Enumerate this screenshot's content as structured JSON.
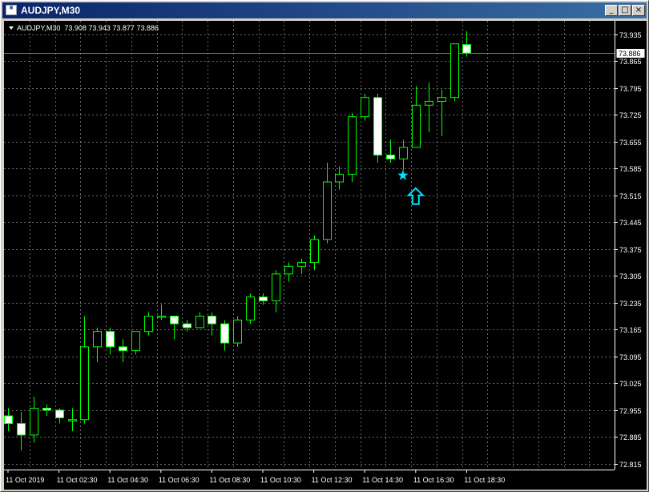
{
  "window": {
    "title": "AUDJPY,M30",
    "icon_name": "chart-window-icon",
    "minimize_label": "_",
    "restore_label": "□",
    "close_label": "×"
  },
  "chart_header": {
    "symbol": "AUDJPY,M30",
    "values": "73.908 73.943 73.877 73.886"
  },
  "colors": {
    "background": "#000000",
    "grid": "#c0c0c0",
    "bull_candle_fill": "#000000",
    "bear_candle_fill": "#ffffff",
    "candle_outline": "#00ff00",
    "bid_line": "#808080",
    "signal": "#00e0ff",
    "axis_text": "#ffffff"
  },
  "chart_data": {
    "type": "candlestick",
    "ylim": [
      72.8,
      73.97
    ],
    "y_ticks": [
      "73.935",
      "73.865",
      "73.795",
      "73.725",
      "73.655",
      "73.585",
      "73.515",
      "73.445",
      "73.375",
      "73.305",
      "73.235",
      "73.165",
      "73.095",
      "73.025",
      "72.955",
      "72.885",
      "72.815"
    ],
    "x_ticks": [
      "11 Oct 2019",
      "11 Oct 02:30",
      "11 Oct 04:30",
      "11 Oct 06:30",
      "11 Oct 08:30",
      "11 Oct 10:30",
      "11 Oct 12:30",
      "11 Oct 14:30",
      "11 Oct 16:30",
      "11 Oct 18:30"
    ],
    "current_price": "73.886",
    "candles": [
      {
        "o": 72.94,
        "h": 72.96,
        "l": 72.9,
        "c": 72.92
      },
      {
        "o": 72.92,
        "h": 72.95,
        "l": 72.85,
        "c": 72.89
      },
      {
        "o": 72.89,
        "h": 72.99,
        "l": 72.87,
        "c": 72.96
      },
      {
        "o": 72.96,
        "h": 72.97,
        "l": 72.94,
        "c": 72.955
      },
      {
        "o": 72.955,
        "h": 72.96,
        "l": 72.92,
        "c": 72.935
      },
      {
        "o": 72.93,
        "h": 72.96,
        "l": 72.9,
        "c": 72.93
      },
      {
        "o": 72.93,
        "h": 73.2,
        "l": 72.92,
        "c": 73.12
      },
      {
        "o": 73.12,
        "h": 73.17,
        "l": 73.08,
        "c": 73.16
      },
      {
        "o": 73.16,
        "h": 73.17,
        "l": 73.1,
        "c": 73.12
      },
      {
        "o": 73.12,
        "h": 73.14,
        "l": 73.08,
        "c": 73.11
      },
      {
        "o": 73.11,
        "h": 73.16,
        "l": 73.1,
        "c": 73.16
      },
      {
        "o": 73.16,
        "h": 73.21,
        "l": 73.15,
        "c": 73.2
      },
      {
        "o": 73.2,
        "h": 73.23,
        "l": 73.19,
        "c": 73.2
      },
      {
        "o": 73.2,
        "h": 73.2,
        "l": 73.14,
        "c": 73.18
      },
      {
        "o": 73.18,
        "h": 73.19,
        "l": 73.16,
        "c": 73.17
      },
      {
        "o": 73.17,
        "h": 73.21,
        "l": 73.17,
        "c": 73.2
      },
      {
        "o": 73.2,
        "h": 73.21,
        "l": 73.15,
        "c": 73.18
      },
      {
        "o": 73.18,
        "h": 73.19,
        "l": 73.11,
        "c": 73.13
      },
      {
        "o": 73.13,
        "h": 73.2,
        "l": 73.12,
        "c": 73.19
      },
      {
        "o": 73.19,
        "h": 73.26,
        "l": 73.18,
        "c": 73.25
      },
      {
        "o": 73.25,
        "h": 73.26,
        "l": 73.23,
        "c": 73.24
      },
      {
        "o": 73.24,
        "h": 73.32,
        "l": 73.21,
        "c": 73.31
      },
      {
        "o": 73.31,
        "h": 73.34,
        "l": 73.29,
        "c": 73.33
      },
      {
        "o": 73.33,
        "h": 73.35,
        "l": 73.31,
        "c": 73.34
      },
      {
        "o": 73.34,
        "h": 73.41,
        "l": 73.32,
        "c": 73.4
      },
      {
        "o": 73.4,
        "h": 73.6,
        "l": 73.39,
        "c": 73.55
      },
      {
        "o": 73.55,
        "h": 73.59,
        "l": 73.53,
        "c": 73.57
      },
      {
        "o": 73.57,
        "h": 73.73,
        "l": 73.55,
        "c": 73.72
      },
      {
        "o": 73.72,
        "h": 73.78,
        "l": 73.71,
        "c": 73.77
      },
      {
        "o": 73.77,
        "h": 73.78,
        "l": 73.6,
        "c": 73.62
      },
      {
        "o": 73.62,
        "h": 73.66,
        "l": 73.6,
        "c": 73.61
      },
      {
        "o": 73.61,
        "h": 73.66,
        "l": 73.58,
        "c": 73.64
      },
      {
        "o": 73.64,
        "h": 73.8,
        "l": 73.64,
        "c": 73.75
      },
      {
        "o": 73.75,
        "h": 73.81,
        "l": 73.68,
        "c": 73.76
      },
      {
        "o": 73.76,
        "h": 73.79,
        "l": 73.67,
        "c": 73.77
      },
      {
        "o": 73.77,
        "h": 73.91,
        "l": 73.76,
        "c": 73.91
      },
      {
        "o": 73.908,
        "h": 73.943,
        "l": 73.877,
        "c": 73.886
      }
    ],
    "signal_star": {
      "index": 31,
      "price": 73.567,
      "icon_name": "star-signal-icon"
    },
    "signal_arrow": {
      "index": 32,
      "price": 73.515,
      "icon_name": "up-arrow-signal-icon"
    }
  }
}
